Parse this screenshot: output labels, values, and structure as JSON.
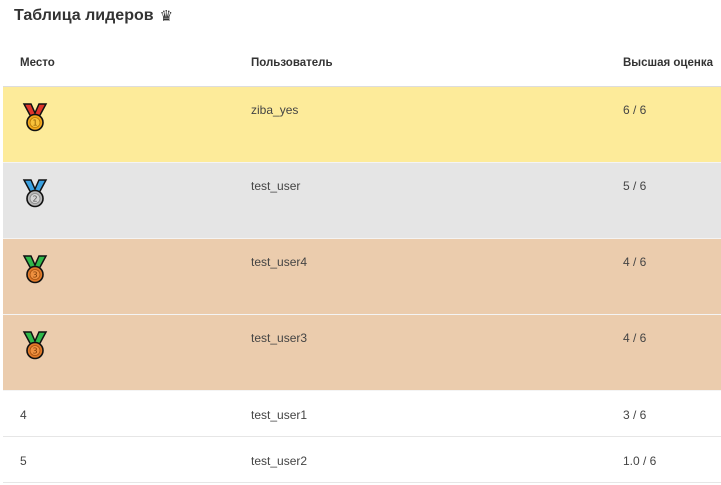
{
  "title": "Таблица лидеров",
  "title_icon": "crown-icon",
  "columns": {
    "place": "Место",
    "user": "Пользователь",
    "score": "Высшая оценка"
  },
  "medal_rows": [
    {
      "medal": "gold-medal-icon",
      "medal_number": "1",
      "user": "ziba_yes",
      "score": "6 / 6"
    },
    {
      "medal": "silver-medal-icon",
      "medal_number": "2",
      "user": "test_user",
      "score": "5 / 6"
    },
    {
      "medal": "bronze-medal-icon",
      "medal_number": "3",
      "user": "test_user4",
      "score": "4 / 6"
    },
    {
      "medal": "bronze-medal-icon",
      "medal_number": "3",
      "user": "test_user3",
      "score": "4 / 6"
    }
  ],
  "plain_rows": [
    {
      "place": "4",
      "user": "test_user1",
      "score": "3 / 6"
    },
    {
      "place": "5",
      "user": "test_user2",
      "score": "1.0 / 6"
    }
  ],
  "colors": {
    "gold_row": "#fdeb9a",
    "silver_row": "#e5e5e5",
    "bronze_row": "#ebccad",
    "gold_ribbon": "#e0352b",
    "silver_ribbon": "#3aa0e0",
    "bronze_ribbon": "#2fb84a"
  }
}
